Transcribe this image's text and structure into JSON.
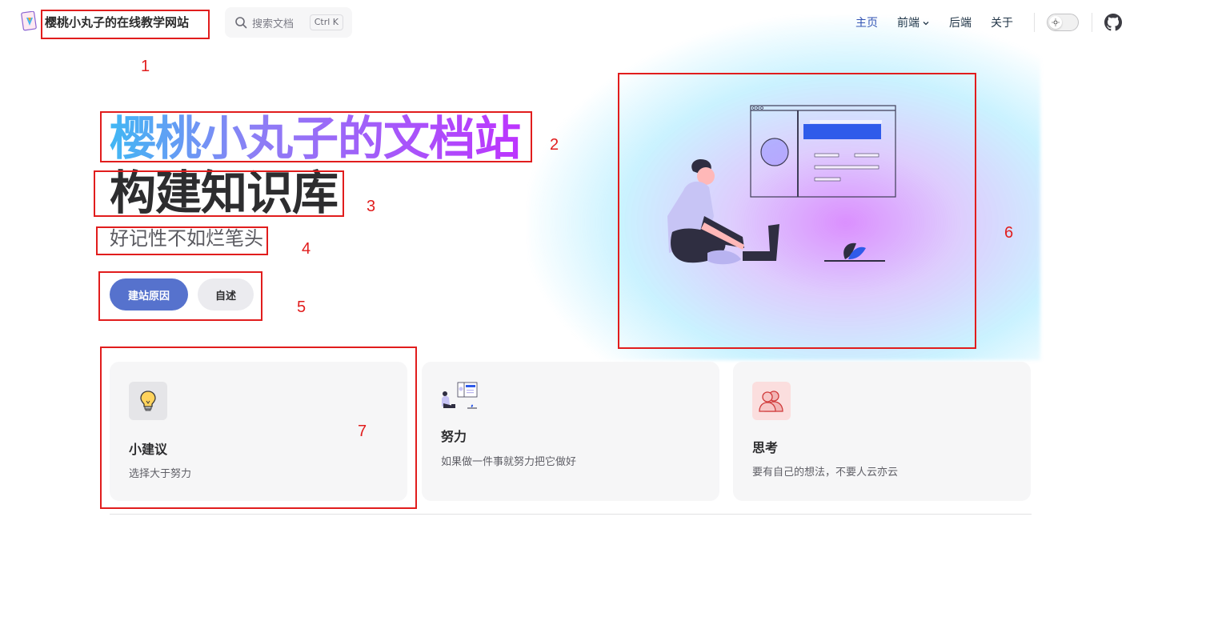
{
  "nav": {
    "site_title": "樱桃小丸子的在线教学网站",
    "search_placeholder": "搜索文档",
    "search_shortcut": "Ctrl K",
    "menu": [
      {
        "label": "主页",
        "active": true
      },
      {
        "label": "前端",
        "dropdown": true
      },
      {
        "label": "后端"
      },
      {
        "label": "关于"
      }
    ]
  },
  "hero": {
    "name": "樱桃小丸子的文档站",
    "text": "构建知识库",
    "tagline": "好记性不如烂笔头",
    "actions": [
      {
        "label": "建站原因",
        "theme": "brand"
      },
      {
        "label": "自述",
        "theme": "alt"
      }
    ]
  },
  "features": [
    {
      "icon": "lightbulb-icon",
      "title": "小建议",
      "details": "选择大于努力"
    },
    {
      "icon": "person-laptop-illustration-icon",
      "title": "努力",
      "details": "如果做一件事就努力把它做好"
    },
    {
      "icon": "people-icon",
      "title": "思考",
      "details": "要有自己的想法，不要人云亦云"
    }
  ],
  "annotations": [
    "1",
    "2",
    "3",
    "4",
    "5",
    "6",
    "7"
  ],
  "colors": {
    "brand": "#5672cd",
    "active_link": "#3451b2",
    "gradient_start": "#41b7f4",
    "gradient_end": "#bd34fe",
    "annotation": "#e11d1d"
  }
}
